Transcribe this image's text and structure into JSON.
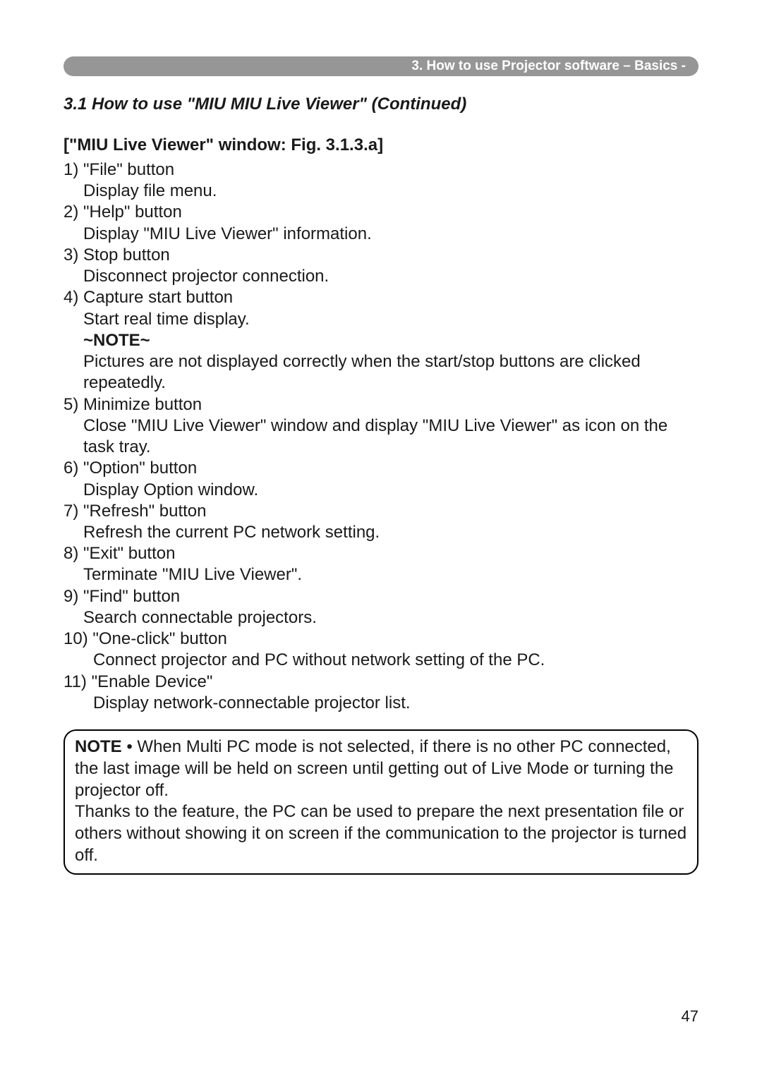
{
  "header": {
    "breadcrumb": "3. How to use Projector software – Basics -"
  },
  "section_title": "3.1 How to use \"MIU MIU Live Viewer\" (Continued)",
  "subheading": "[\"MIU Live Viewer\" window: Fig. 3.1.3.a]",
  "items": [
    {
      "num": "1)",
      "title": "\"File\" button",
      "desc": "Display file menu."
    },
    {
      "num": "2)",
      "title": "\"Help\" button",
      "desc": "Display \"MIU Live Viewer\" information."
    },
    {
      "num": "3)",
      "title": "Stop button",
      "desc": "Disconnect projector connection."
    },
    {
      "num": "4)",
      "title": "Capture start button",
      "desc": "Start real time display.",
      "note_label": "~NOTE~",
      "note_desc": "Pictures are not displayed correctly when the start/stop buttons are clicked repeatedly."
    },
    {
      "num": "5)",
      "title": "Minimize button",
      "desc": "Close \"MIU Live Viewer\" window and display \"MIU Live Viewer\" as icon on the task tray."
    },
    {
      "num": "6)",
      "title": "\"Option\" button",
      "desc": "Display Option window."
    },
    {
      "num": "7)",
      "title": "\"Refresh\" button",
      "desc": "Refresh the current PC network setting."
    },
    {
      "num": "8)",
      "title": "\"Exit\" button",
      "desc": "Terminate \"MIU Live Viewer\"."
    },
    {
      "num": "9)",
      "title": "\"Find\" button",
      "desc": "Search connectable projectors."
    },
    {
      "num": "10)",
      "title": "\"One-click\" button",
      "desc": "Connect projector and PC without network setting of the PC."
    },
    {
      "num": "11)",
      "title": "\"Enable Device\"",
      "desc": "Display network-connectable projector list."
    }
  ],
  "note_box": {
    "label": "NOTE",
    "bullet": " • ",
    "text1": "When Multi PC mode is not selected, if there is no other PC connected, the last image will be held on screen until getting out of Live Mode or turning the projector off.",
    "text2": "Thanks to the feature, the PC can be used to prepare the next presentation file or others without showing it on screen if the communication to the projector is turned off."
  },
  "page_number": "47"
}
